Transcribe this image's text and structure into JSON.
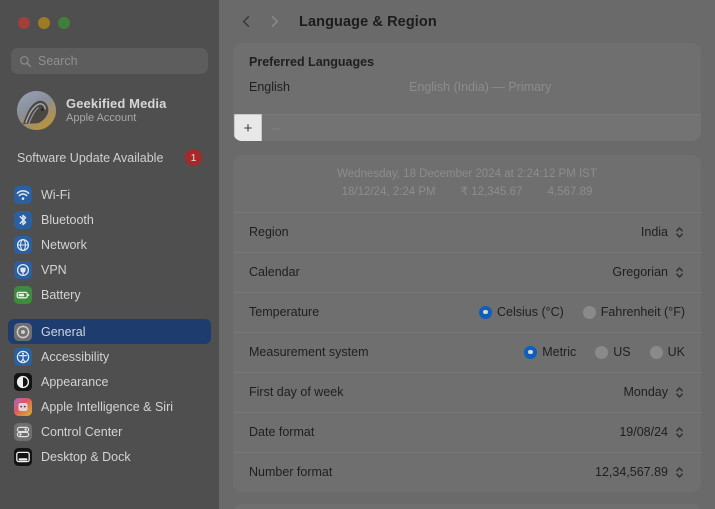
{
  "window": {
    "traffic_lights": [
      "close",
      "minimize",
      "zoom"
    ]
  },
  "sidebar": {
    "search": {
      "placeholder": "Search",
      "value": "",
      "icon": "search-icon"
    },
    "account": {
      "name": "Geekified Media",
      "subtitle": "Apple Account",
      "avatar": "zebra-photo-avatar"
    },
    "software_update": {
      "label": "Software Update Available",
      "badge": "1",
      "badge_color": "#a6282a"
    },
    "groups": [
      {
        "items": [
          {
            "label": "Wi-Fi",
            "icon": "wifi-icon",
            "icon_color": "#2a5fa0",
            "selected": false
          },
          {
            "label": "Bluetooth",
            "icon": "bluetooth-icon",
            "icon_color": "#2a5fa0",
            "selected": false
          },
          {
            "label": "Network",
            "icon": "network-globe-icon",
            "icon_color": "#2a5fa0",
            "selected": false
          },
          {
            "label": "VPN",
            "icon": "vpn-icon",
            "icon_color": "#2a5fa0",
            "selected": false
          },
          {
            "label": "Battery",
            "icon": "battery-icon",
            "icon_color": "#3f8a3f",
            "selected": false
          }
        ]
      },
      {
        "items": [
          {
            "label": "General",
            "icon": "gear-icon",
            "icon_color": "#6f6f6f",
            "selected": true
          },
          {
            "label": "Accessibility",
            "icon": "accessibility-icon",
            "icon_color": "#2a5fa0",
            "selected": false
          },
          {
            "label": "Appearance",
            "icon": "appearance-icon",
            "icon_color": "#131313",
            "selected": false
          },
          {
            "label": "Apple Intelligence & Siri",
            "icon": "apple-intelligence-icon",
            "icon_color": "gradient",
            "selected": false
          },
          {
            "label": "Control Center",
            "icon": "control-center-icon",
            "icon_color": "#6f6f6f",
            "selected": false
          },
          {
            "label": "Desktop & Dock",
            "icon": "desktop-dock-icon",
            "icon_color": "#131313",
            "selected": false
          }
        ]
      }
    ],
    "selected_item": "General"
  },
  "toolbar": {
    "back_icon": "chevron-left-icon",
    "forward_icon": "chevron-right-icon",
    "title": "Language & Region"
  },
  "preferred_languages": {
    "title": "Preferred Languages",
    "rows": [
      {
        "name": "English",
        "detail": "English (India) — Primary"
      }
    ],
    "add_button": "+",
    "remove_button": "–"
  },
  "region_card": {
    "preview": {
      "line1": "Wednesday, 18 December 2024 at 2:24:12 PM IST",
      "line2_date": "18/12/24, 2:24 PM",
      "line2_currency": "₹ 12,345.67",
      "line2_number": "4,567.89"
    },
    "rows": [
      {
        "type": "select",
        "label": "Region",
        "value": "India"
      },
      {
        "type": "select",
        "label": "Calendar",
        "value": "Gregorian"
      },
      {
        "type": "radio",
        "label": "Temperature",
        "options": [
          {
            "label": "Celsius (°C)",
            "selected": true
          },
          {
            "label": "Fahrenheit (°F)",
            "selected": false
          }
        ]
      },
      {
        "type": "radio",
        "label": "Measurement system",
        "options": [
          {
            "label": "Metric",
            "selected": true
          },
          {
            "label": "US",
            "selected": false
          },
          {
            "label": "UK",
            "selected": false
          }
        ]
      },
      {
        "type": "select",
        "label": "First day of week",
        "value": "Monday"
      },
      {
        "type": "select",
        "label": "Date format",
        "value": "19/08/24"
      },
      {
        "type": "select",
        "label": "Number format",
        "value": "12,34,567.89"
      }
    ]
  },
  "colors": {
    "accent_blue": "#0c5fbc",
    "selected_row": "#1e3c6e",
    "badge_red": "#a6282a",
    "sidebar_bg": "#4f4f4f",
    "content_bg": "#6a6a6a",
    "card_bg": "#6f6f6f"
  }
}
